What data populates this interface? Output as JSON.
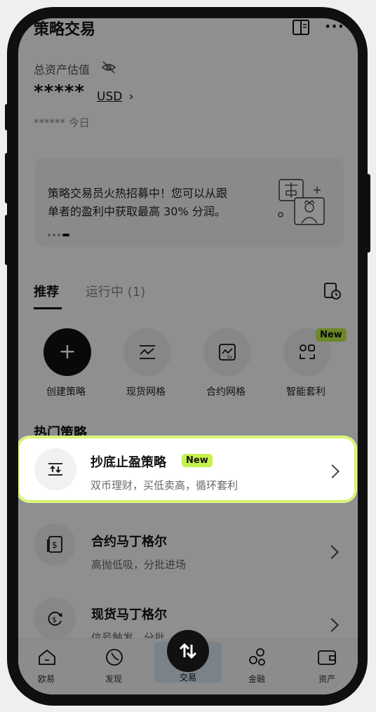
{
  "header": {
    "title": "策略交易"
  },
  "assets": {
    "label": "总资产估值",
    "masked_value": "*****",
    "currency": "USD",
    "today": "****** 今日"
  },
  "banner": {
    "text_line1": "策略交易员火热招募中！您可以从跟",
    "text_line2": "单者的盈利中获取最高 30% 分润。"
  },
  "tabs": [
    {
      "label": "推荐"
    },
    {
      "label": "运行中 (1)"
    }
  ],
  "quick_actions": [
    {
      "label": "创建策略"
    },
    {
      "label": "现货网格"
    },
    {
      "label": "合约网格"
    },
    {
      "label": "智能套利",
      "badge": "New"
    }
  ],
  "section_title": "热门策略",
  "strategies": [
    {
      "title": "抄底止盈策略",
      "badge": "New",
      "desc": "双币理财，买低卖高，循环套利"
    },
    {
      "title": "合约马丁格尔",
      "desc": "高抛低吸，分批进场"
    },
    {
      "title": "现货马丁格尔",
      "desc": "信号触发，分批"
    }
  ],
  "bottom_nav": [
    {
      "label": "欧易"
    },
    {
      "label": "发现"
    },
    {
      "label": "交易"
    },
    {
      "label": "金融"
    },
    {
      "label": "资产"
    }
  ],
  "colors": {
    "accent": "#c5f24a",
    "card_highlight_border": "#d6f56a"
  }
}
